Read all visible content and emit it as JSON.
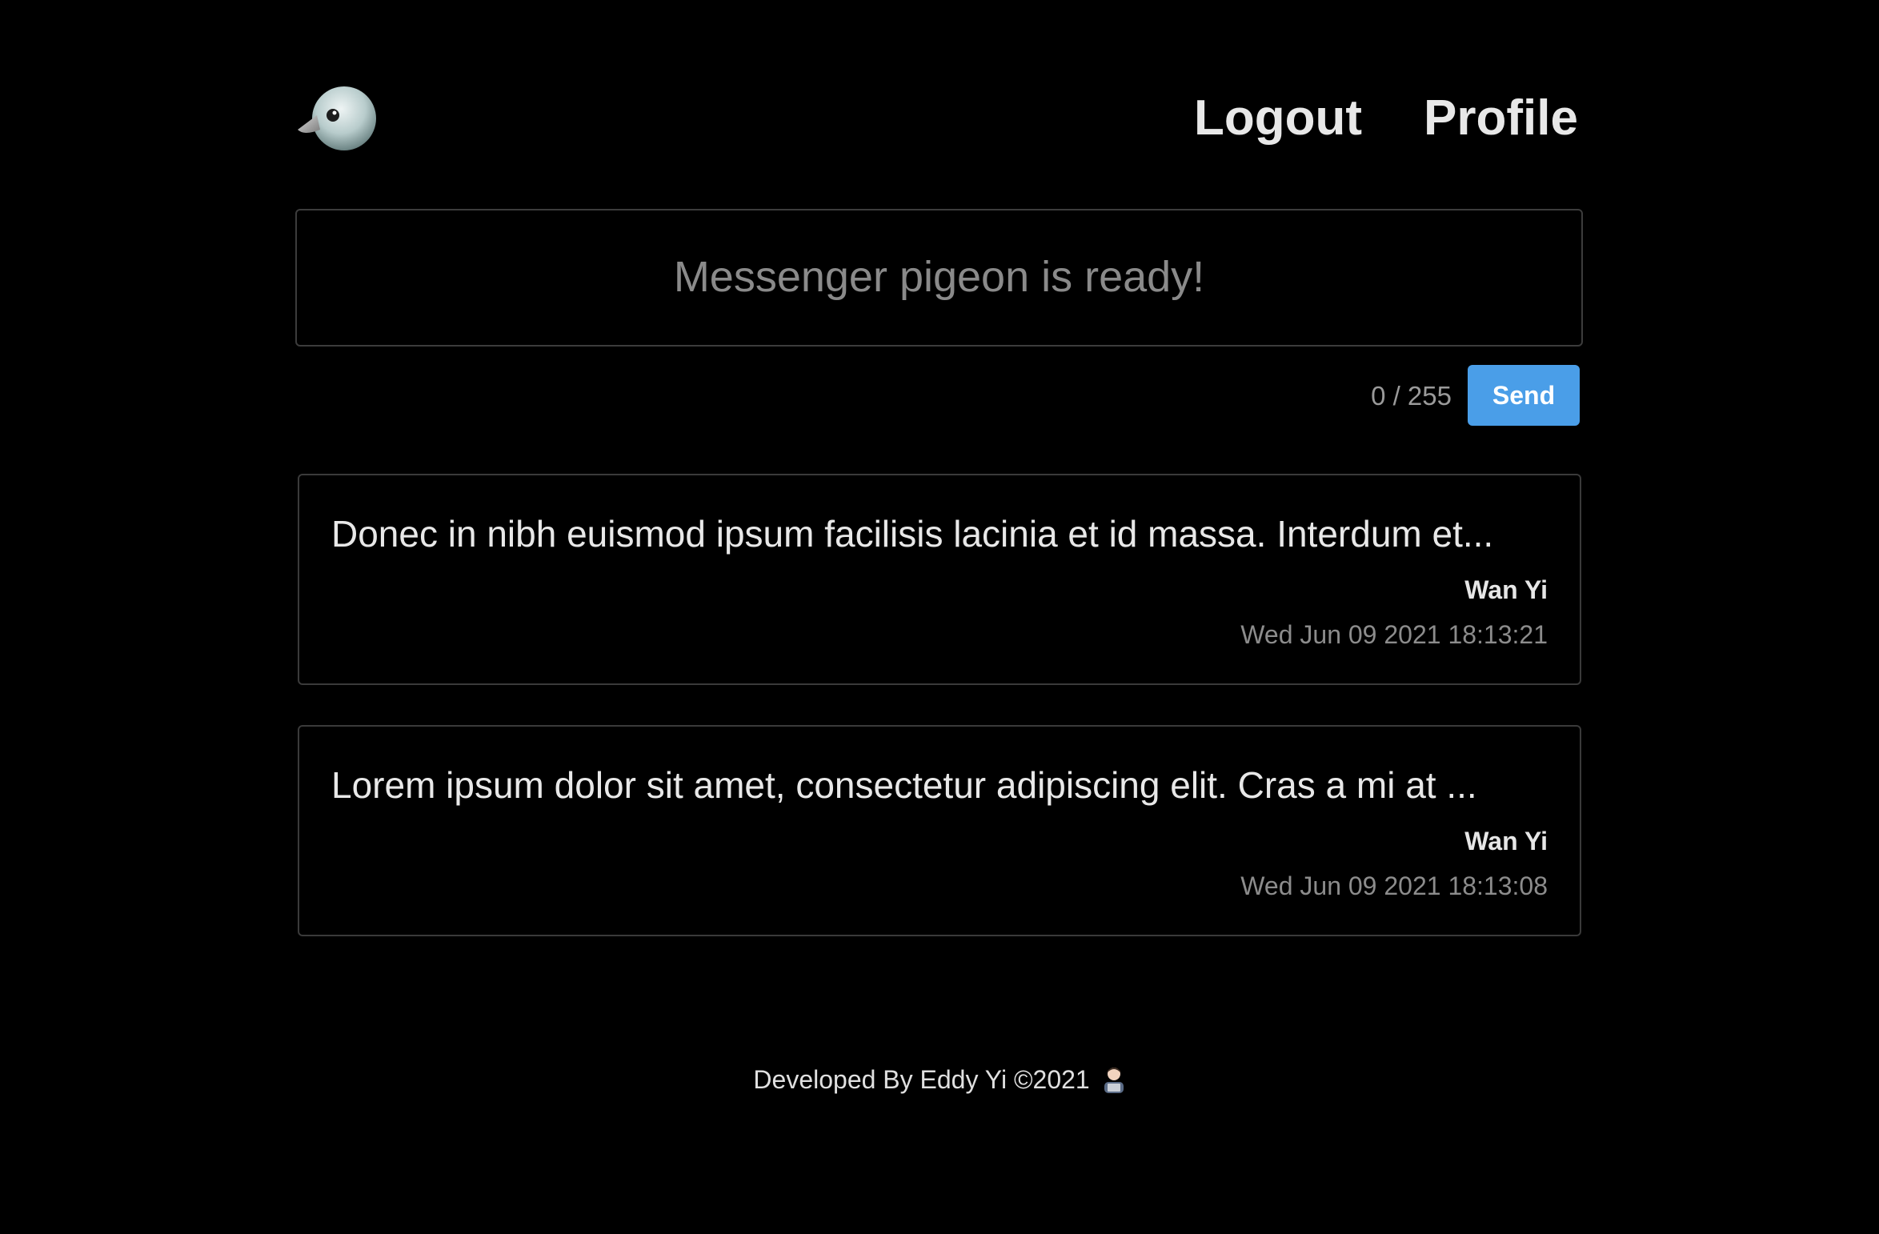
{
  "header": {
    "logo_icon": "pigeon-icon",
    "nav": {
      "logout_label": "Logout",
      "profile_label": "Profile"
    }
  },
  "composer": {
    "placeholder": "Messenger pigeon is ready!",
    "value": "",
    "counter": "0 / 255",
    "send_label": "Send"
  },
  "messages": [
    {
      "text": "Donec in nibh euismod ipsum facilisis lacinia et id massa. Interdum et...",
      "author": "Wan Yi",
      "timestamp": "Wed Jun 09 2021 18:13:21"
    },
    {
      "text": "Lorem ipsum dolor sit amet, consectetur adipiscing elit. Cras a mi at ...",
      "author": "Wan Yi",
      "timestamp": "Wed Jun 09 2021 18:13:08"
    }
  ],
  "footer": {
    "text": "Developed By Eddy Yi ©2021",
    "icon": "developer-icon"
  },
  "colors": {
    "background": "#000000",
    "accent": "#4a9ee8",
    "border": "#3c3c3c",
    "muted_text": "#8c8c8c"
  }
}
